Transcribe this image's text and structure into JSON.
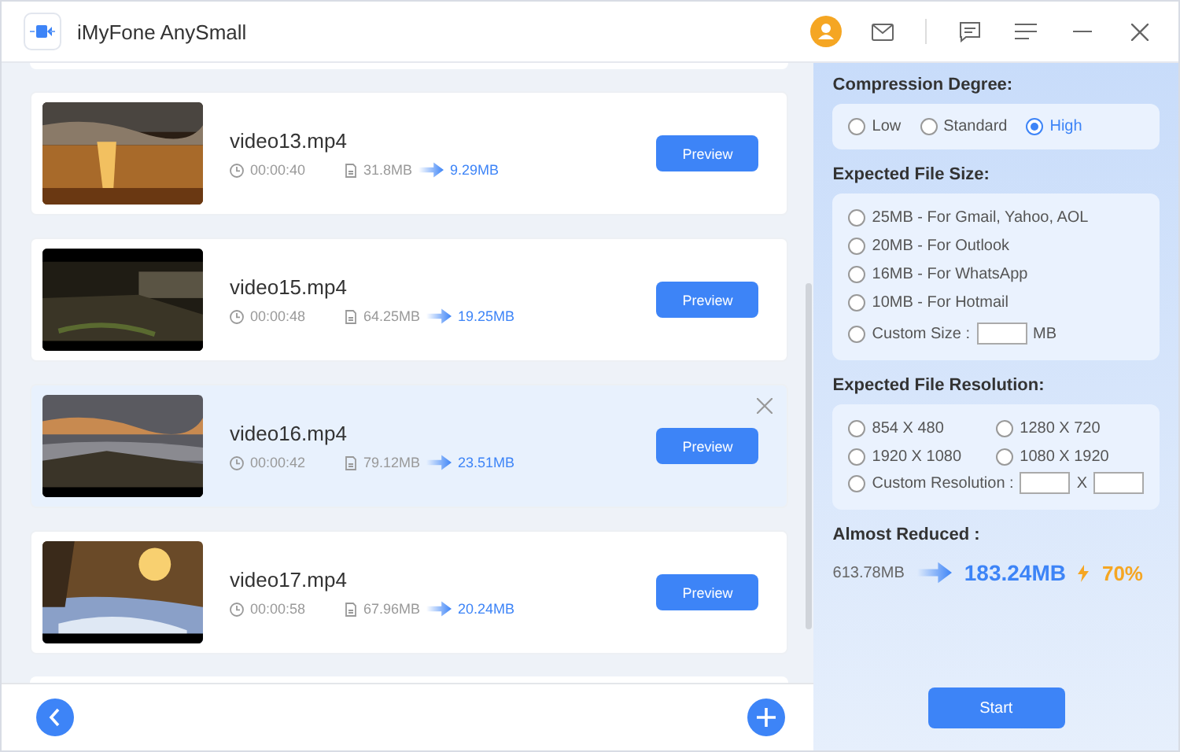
{
  "window": {
    "title": "iMyFone AnySmall"
  },
  "videos": [
    {
      "name": "video13.mp4",
      "duration": "00:00:40",
      "original_size": "31.8MB",
      "compressed_size": "9.29MB",
      "highlighted": false,
      "preview_label": "Preview"
    },
    {
      "name": "video15.mp4",
      "duration": "00:00:48",
      "original_size": "64.25MB",
      "compressed_size": "19.25MB",
      "highlighted": false,
      "preview_label": "Preview"
    },
    {
      "name": "video16.mp4",
      "duration": "00:00:42",
      "original_size": "79.12MB",
      "compressed_size": "23.51MB",
      "highlighted": true,
      "preview_label": "Preview"
    },
    {
      "name": "video17.mp4",
      "duration": "00:00:58",
      "original_size": "67.96MB",
      "compressed_size": "20.24MB",
      "highlighted": false,
      "preview_label": "Preview"
    }
  ],
  "settings": {
    "compression": {
      "title": "Compression Degree:",
      "options": [
        {
          "label": "Low",
          "selected": false
        },
        {
          "label": "Standard",
          "selected": false
        },
        {
          "label": "High",
          "selected": true
        }
      ]
    },
    "file_size": {
      "title": "Expected File Size:",
      "options": [
        {
          "label": "25MB - For Gmail, Yahoo, AOL",
          "selected": false
        },
        {
          "label": "20MB - For Outlook",
          "selected": false
        },
        {
          "label": "16MB - For WhatsApp",
          "selected": false
        },
        {
          "label": "10MB - For Hotmail",
          "selected": false
        }
      ],
      "custom": {
        "label": "Custom Size :",
        "unit": "MB",
        "selected": false
      }
    },
    "resolution": {
      "title": "Expected File Resolution:",
      "options": [
        {
          "label": "854 X 480",
          "selected": false
        },
        {
          "label": "1280 X 720",
          "selected": false
        },
        {
          "label": "1920 X 1080",
          "selected": false
        },
        {
          "label": "1080 X 1920",
          "selected": false
        }
      ],
      "custom": {
        "label": "Custom Resolution :",
        "separator": "X",
        "selected": false
      }
    },
    "reduced": {
      "title": "Almost Reduced :",
      "original": "613.78MB",
      "compressed": "183.24MB",
      "percent": "70%"
    },
    "start_label": "Start"
  }
}
